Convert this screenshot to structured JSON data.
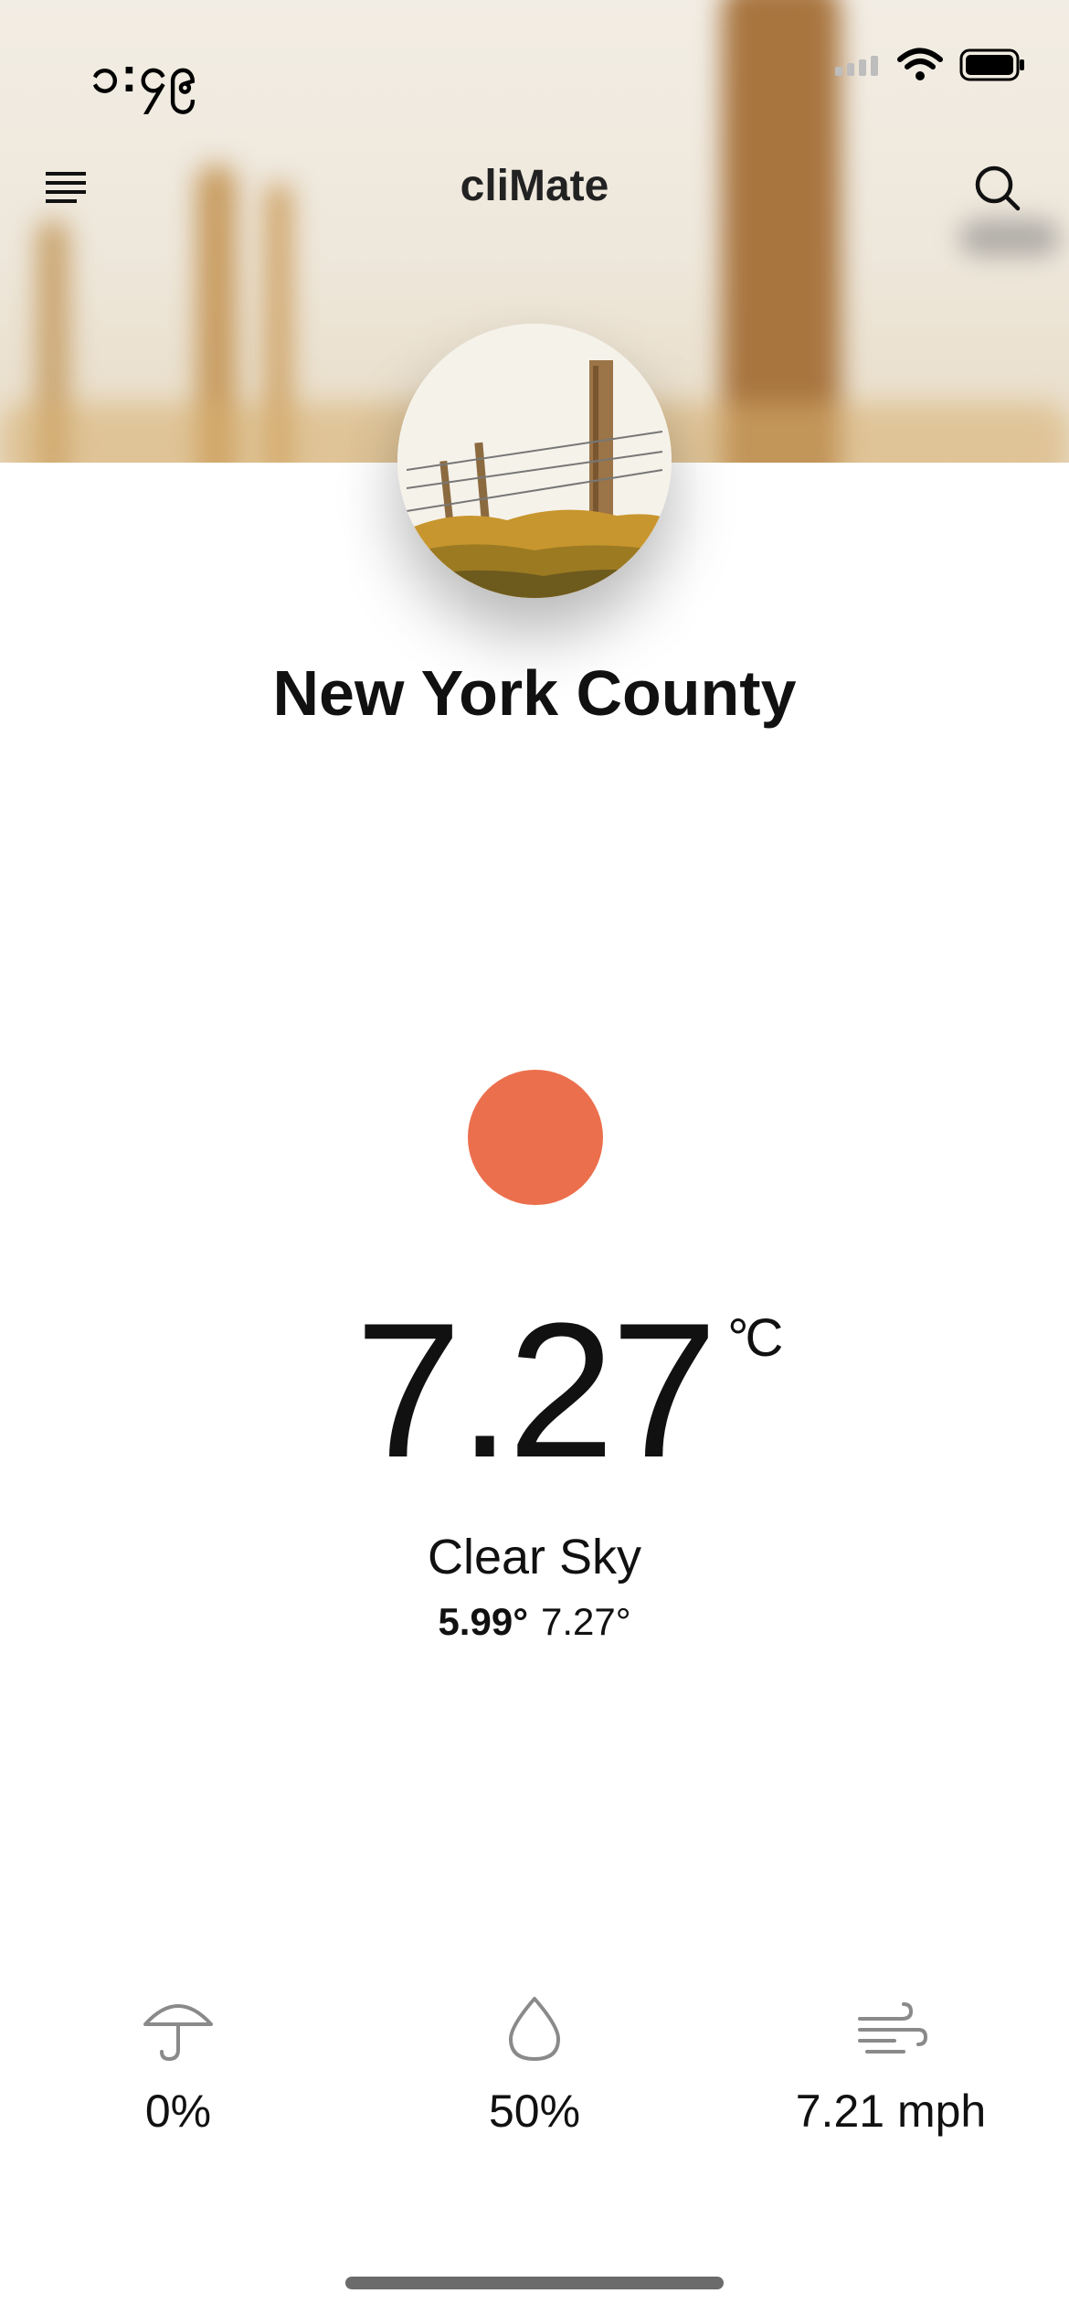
{
  "status_bar": {
    "time": "၁:၄၉"
  },
  "header": {
    "title": "cliMate"
  },
  "location": {
    "name": "New York County"
  },
  "weather": {
    "icon": "sun-icon",
    "icon_color": "#ec6f4d",
    "temperature": "7.27",
    "unit": "°C",
    "condition": "Clear Sky",
    "low": "5.99°",
    "high": "7.27°"
  },
  "stats": {
    "precipitation": {
      "icon": "umbrella-icon",
      "value": "0%"
    },
    "humidity": {
      "icon": "droplet-icon",
      "value": "50%"
    },
    "wind": {
      "icon": "wind-icon",
      "value": "7.21 mph"
    }
  }
}
